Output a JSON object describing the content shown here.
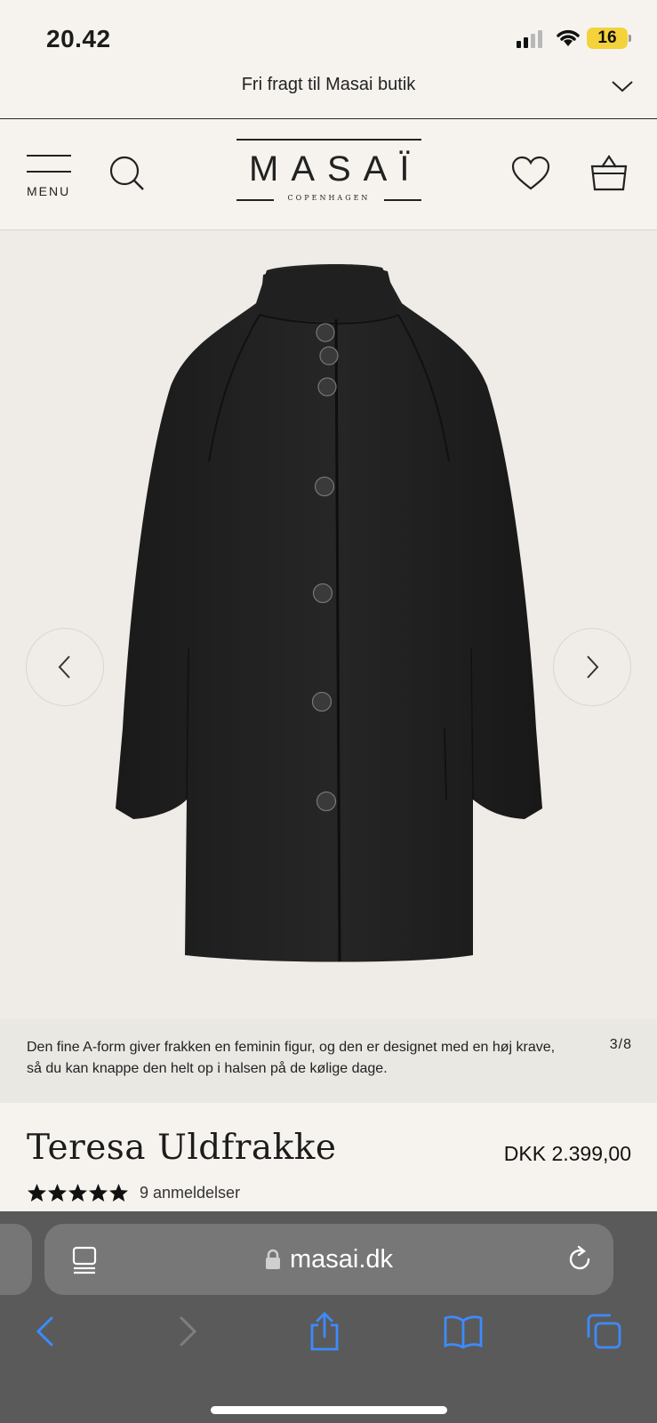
{
  "status_bar": {
    "time": "20.42",
    "battery": "16",
    "signal_icon": "cellular-signal-icon",
    "wifi_icon": "wifi-icon"
  },
  "promo": {
    "text": "Fri fragt til Masai butik",
    "chevron_icon": "chevron-down-icon"
  },
  "header": {
    "menu_label": "MENU",
    "logo_word": "MASAÏ",
    "logo_sub": "COPENHAGEN",
    "icons": [
      "menu-icon",
      "search-icon",
      "heart-icon",
      "shopping-bag-icon"
    ]
  },
  "gallery": {
    "image_alt": "black wool coat",
    "prev_icon": "chevron-left-icon",
    "next_icon": "chevron-right-icon",
    "caption": "Den fine A-form giver frakken en feminin figur, og den er designet med en høj krave, så du kan knappe den helt op i halsen på de kølige dage.",
    "counter": "3/8"
  },
  "product": {
    "title": "Teresa Uldfrakke",
    "price": "DKK 2.399,00",
    "rating_stars": 5,
    "reviews": "9 anmeldelser"
  },
  "safari": {
    "url": "masai.dk",
    "icons": [
      "reader-icon",
      "lock-icon",
      "reload-icon",
      "back-icon",
      "forward-icon",
      "share-icon",
      "bookmarks-icon",
      "tabs-icon"
    ]
  },
  "colors": {
    "page_bg": "#f6f3ee",
    "gallery_bg": "#efebe7",
    "caption_bg": "#e9e8e3",
    "safari_bg": "#5a5a5a",
    "safari_accent": "#3d8bff",
    "battery": "#f4d23a"
  }
}
